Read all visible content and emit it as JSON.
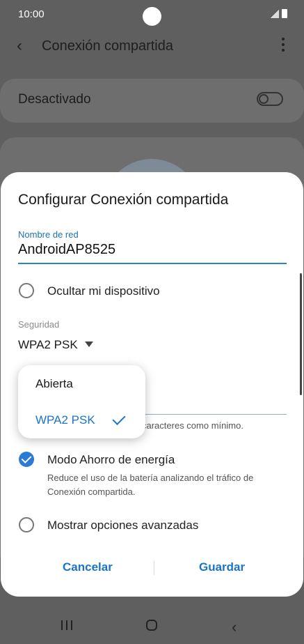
{
  "status": {
    "time": "10:00"
  },
  "appbar": {
    "title": "Conexión compartida"
  },
  "hotspot_toggle": {
    "label": "Desactivado",
    "state": "off"
  },
  "dialog": {
    "title": "Configurar Conexión compartida",
    "network_name": {
      "label": "Nombre de red",
      "value": "AndroidAP8525"
    },
    "hide_device": {
      "label": "Ocultar mi dispositivo",
      "checked": false
    },
    "security": {
      "label": "Seguridad",
      "value": "WPA2 PSK"
    },
    "password_hint": "caracteres como mínimo.",
    "power_saving": {
      "label": "Modo Ahorro de energía",
      "checked": true,
      "description": "Reduce el uso de la batería analizando el tráfico de Conexión compartida."
    },
    "advanced": {
      "label": "Mostrar opciones avanzadas",
      "checked": false
    },
    "cancel_label": "Cancelar",
    "save_label": "Guardar"
  },
  "security_dropdown": {
    "options": [
      "Abierta",
      "WPA2 PSK"
    ],
    "selected": "WPA2 PSK"
  },
  "colors": {
    "accent": "#1a74c7",
    "checkbox": "#2a7ad6"
  }
}
